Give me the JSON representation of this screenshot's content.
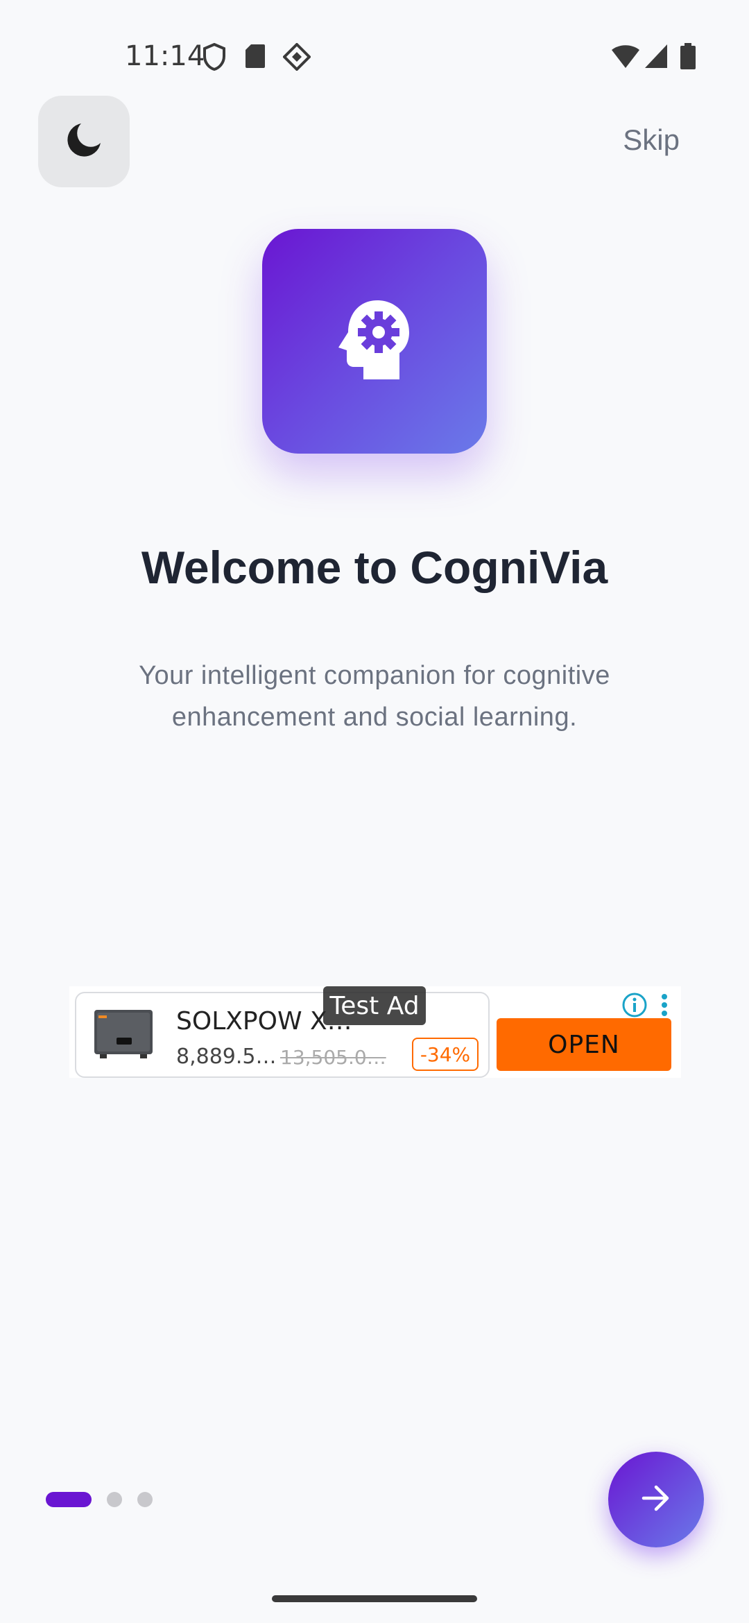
{
  "status_bar": {
    "time": "11:14",
    "left_icons": [
      "shield-icon",
      "sd-card-icon",
      "diamond-grid-icon"
    ],
    "right_icons": [
      "wifi-icon",
      "signal-icon",
      "battery-icon"
    ]
  },
  "header": {
    "theme_toggle_icon": "moon-icon",
    "skip_label": "Skip"
  },
  "hero": {
    "logo_icon": "head-gear-icon",
    "title": "Welcome to CogniVia",
    "subtitle": "Your intelligent companion for cognitive enhancement and social learning."
  },
  "ad": {
    "label": "Test Ad",
    "product_name": "SOLXPOW X…",
    "price": "8,889.5…",
    "old_price": "13,505.0…",
    "discount": "-34%",
    "cta_label": "OPEN",
    "cta_color": "#ff6a00"
  },
  "pagination": {
    "total": 3,
    "current": 1
  },
  "colors": {
    "accent": "#6a16d2",
    "accent_end": "#6a7ae9",
    "background": "#f8f9fb",
    "title": "#1f2533",
    "muted": "#6b7280"
  }
}
